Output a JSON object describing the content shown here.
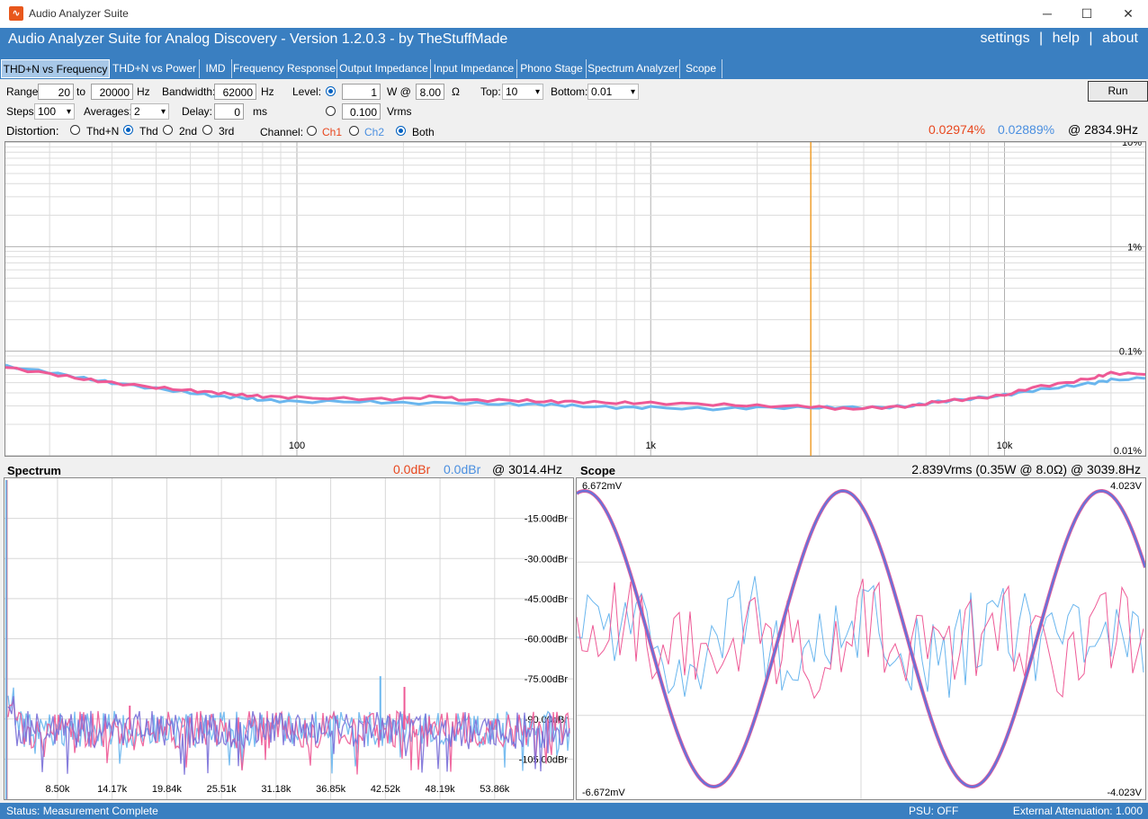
{
  "window": {
    "title": "Audio Analyzer Suite"
  },
  "banner": {
    "title": "Audio Analyzer Suite for Analog Discovery - Version   1.2.0.3   - by TheStuffMade",
    "links": [
      "settings",
      "|",
      "help",
      "|",
      "about"
    ]
  },
  "tabs": [
    "THD+N vs Frequency",
    "THD+N vs Power",
    "IMD",
    "Frequency Response",
    "Output Impedance",
    "Input Impedance",
    "Phono Stage",
    "Spectrum Analyzer",
    "Scope"
  ],
  "controls": {
    "range_label": "Range:",
    "range_from": "20",
    "to_label": "to",
    "range_to": "20000",
    "hz1": "Hz",
    "bandwidth_label": "Bandwidth:",
    "bandwidth": "62000",
    "hz2": "Hz",
    "level_label": "Level:",
    "level_w": "1",
    "w_at": "W @",
    "ohms": "8.00",
    "ohm_symbol": "Ω",
    "level_vrms": "0.100",
    "vrms_label": "Vrms",
    "top_label": "Top:",
    "top": "10",
    "bottom_label": "Bottom:",
    "bottom": "0.01",
    "steps_label": "Steps:",
    "steps": "100",
    "averages_label": "Averages:",
    "averages": "2",
    "delay_label": "Delay:",
    "delay": "0",
    "ms": "ms",
    "distortion_label": "Distortion:",
    "dist_options": [
      "Thd+N",
      "Thd",
      "2nd",
      "3rd"
    ],
    "channel_label": "Channel:",
    "ch1": "Ch1",
    "ch2": "Ch2",
    "both": "Both",
    "run": "Run"
  },
  "readout": {
    "ch1": "0.02974%",
    "ch2": "0.02889%",
    "freq": "@ 2834.9Hz"
  },
  "colors": {
    "ch1": "#ee5a96",
    "ch2": "#6ab6ee",
    "ch1_text": "#e8471e",
    "ch2_text": "#4a8fe0",
    "cursor": "#f0a030",
    "accent": "#3a7fc1"
  },
  "thd_chart": {
    "x_ticks": [
      "100",
      "1k",
      "10k"
    ],
    "y_ticks": [
      "10%",
      "1%",
      "0.1%",
      "0.01%"
    ],
    "cursor_freq": 2834.9
  },
  "spectrum": {
    "title": "Spectrum",
    "ch1": "0.0dBr",
    "ch2": "0.0dBr",
    "freq": "@ 3014.4Hz",
    "y_ticks": [
      "-15.00dBr",
      "-30.00dBr",
      "-45.00dBr",
      "-60.00dBr",
      "-75.00dBr",
      "-90.00dBr",
      "-105.00dBr"
    ],
    "x_ticks": [
      "8.50k",
      "14.17k",
      "19.84k",
      "25.51k",
      "31.18k",
      "36.85k",
      "42.52k",
      "48.19k",
      "53.86k"
    ]
  },
  "scope": {
    "title": "Scope",
    "readout": "2.839Vrms (0.35W @ 8.0Ω) @ 3039.8Hz",
    "left_top": "6.672mV",
    "left_bottom": "-6.672mV",
    "right_top": "4.023V",
    "right_bottom": "-4.023V"
  },
  "status": {
    "left": "Status: Measurement Complete",
    "psu": "PSU: OFF",
    "atten": "External Attenuation: 1.000"
  },
  "chart_data": [
    {
      "type": "line",
      "title": "",
      "x_scale": "log",
      "xlim": [
        15,
        25000
      ],
      "y_scale": "log",
      "ylim": [
        0.01,
        10
      ],
      "series": [
        {
          "values": [
            [
              15,
              0.07
            ],
            [
              20,
              0.061
            ],
            [
              25,
              0.054
            ],
            [
              30,
              0.05
            ],
            [
              40,
              0.045
            ],
            [
              50,
              0.042
            ],
            [
              60,
              0.04
            ],
            [
              70,
              0.038
            ],
            [
              80,
              0.037
            ],
            [
              100,
              0.036
            ],
            [
              150,
              0.035
            ],
            [
              200,
              0.035
            ],
            [
              250,
              0.037
            ],
            [
              300,
              0.034
            ],
            [
              400,
              0.034
            ],
            [
              500,
              0.033
            ],
            [
              600,
              0.033
            ],
            [
              800,
              0.032
            ],
            [
              1000,
              0.032
            ],
            [
              1500,
              0.031
            ],
            [
              2000,
              0.03
            ],
            [
              2834.9,
              0.02974
            ],
            [
              3500,
              0.028
            ],
            [
              4500,
              0.029
            ],
            [
              5500,
              0.03
            ],
            [
              6500,
              0.033
            ],
            [
              8000,
              0.035
            ],
            [
              10000,
              0.038
            ],
            [
              12000,
              0.045
            ],
            [
              15000,
              0.05
            ],
            [
              18000,
              0.056
            ],
            [
              20000,
              0.062
            ],
            [
              25000,
              0.06
            ]
          ]
        },
        {
          "values": [
            [
              15,
              0.072
            ],
            [
              20,
              0.063
            ],
            [
              25,
              0.055
            ],
            [
              30,
              0.05
            ],
            [
              40,
              0.044
            ],
            [
              50,
              0.04
            ],
            [
              60,
              0.037
            ],
            [
              70,
              0.036
            ],
            [
              80,
              0.034
            ],
            [
              100,
              0.033
            ],
            [
              150,
              0.033
            ],
            [
              200,
              0.032
            ],
            [
              300,
              0.032
            ],
            [
              400,
              0.031
            ],
            [
              500,
              0.031
            ],
            [
              600,
              0.03
            ],
            [
              800,
              0.029
            ],
            [
              1000,
              0.029
            ],
            [
              1500,
              0.028
            ],
            [
              2000,
              0.029
            ],
            [
              2834.9,
              0.02889
            ],
            [
              3500,
              0.029
            ],
            [
              4500,
              0.029
            ],
            [
              5500,
              0.03
            ],
            [
              6500,
              0.033
            ],
            [
              8000,
              0.035
            ],
            [
              10000,
              0.038
            ],
            [
              12000,
              0.042
            ],
            [
              15000,
              0.046
            ],
            [
              18000,
              0.05
            ],
            [
              20000,
              0.053
            ],
            [
              25000,
              0.055
            ]
          ]
        }
      ]
    },
    {
      "type": "line",
      "title": "Spectrum",
      "xlim": [
        3000,
        62000
      ],
      "ylim": [
        -120,
        0
      ],
      "noise_floor_dbr": -94,
      "spurs": [
        {
          "freq": 42000,
          "dbr": -74,
          "channel": "ch2"
        },
        {
          "freq": 44500,
          "dbr": -78,
          "channel": "ch1"
        },
        {
          "freq": 16000,
          "dbr": -85,
          "channel": "ch1"
        }
      ]
    },
    {
      "type": "line",
      "title": "Scope",
      "signal_amplitude_v": 4.023,
      "distortion_amplitude_mv": 6.672,
      "cycles_shown": 2.2
    }
  ]
}
